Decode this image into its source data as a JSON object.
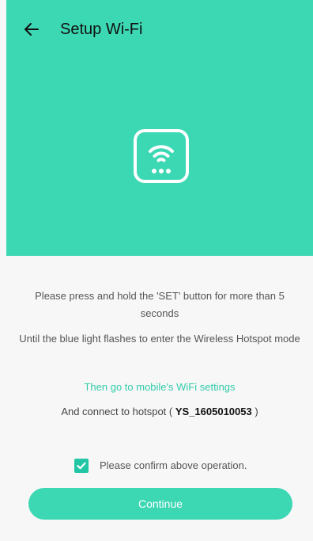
{
  "colors": {
    "accent": "#3cd7b3",
    "checkbox": "#22c6a5",
    "link": "#31ccaa",
    "background": "#f7f7f7"
  },
  "header": {
    "back_icon": "arrow-left-icon",
    "title": "Setup Wi-Fi",
    "device_icon": "wifi-device-icon"
  },
  "instructions": {
    "press_hold": "Please press and hold the 'SET' button for more than 5 seconds",
    "blue_light": "Until the blue light flashes to enter the Wireless Hotspot mode",
    "wifi_settings_link": "Then go to mobile's WiFi settings",
    "connect_prefix": "And connect to hotspot ( ",
    "hotspot_name": "YS_1605010053",
    "connect_suffix": " )"
  },
  "confirm": {
    "checked": true,
    "label": "Please confirm above operation."
  },
  "continue_label": "Continue"
}
